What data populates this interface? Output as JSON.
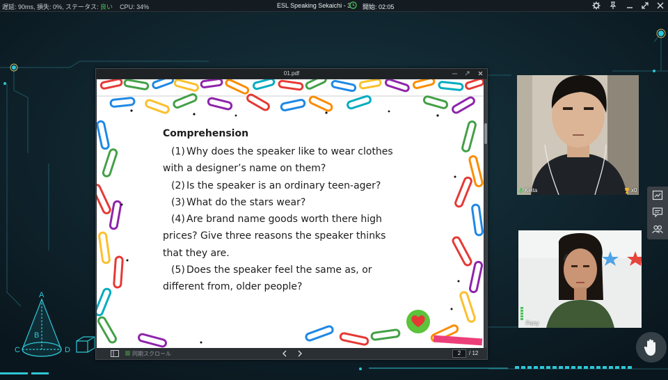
{
  "topbar": {
    "stats_prefix": "遅延: 90ms, 損失: 0%, ステータス: ",
    "status": "良い",
    "cpu": "CPU: 34%",
    "session_title": "ESL Speaking Sekaichi - 3",
    "start_label": "開始: 02:05"
  },
  "pdf": {
    "filename": "01.pdf",
    "heading": "Comprehension",
    "questions": [
      {
        "num": "(1)",
        "lines": [
          "Why does the speaker like to wear clothes",
          "with a designer’s name on them?"
        ]
      },
      {
        "num": "(2)",
        "lines": [
          "Is the speaker is an ordinary teen-ager?"
        ]
      },
      {
        "num": "(3)",
        "lines": [
          "What do the stars wear?"
        ]
      },
      {
        "num": "(4)",
        "lines": [
          "Are brand name goods worth there high",
          "prices? Give three reasons the speaker thinks",
          "that they are."
        ]
      },
      {
        "num": "(5)",
        "lines": [
          "Does the speaker feel the same as, or",
          "different from, older people?"
        ]
      }
    ],
    "sync_scroll_label": "同期スクロール",
    "current_page": "2",
    "total_pages": "/ 12"
  },
  "participants": [
    {
      "name": "Keita",
      "trophies": "x0"
    },
    {
      "name": "Ferry"
    }
  ],
  "decor": {
    "cone_labels": {
      "a": "A",
      "b": "B",
      "c": "C",
      "d": "D"
    }
  },
  "colors": {
    "accent": "#2fc6d6",
    "good": "#4cc35b",
    "background": "#0c1a22"
  },
  "icons": {
    "clock": "clock-icon",
    "settings": "gear-icon",
    "pin": "pin-icon",
    "minimize": "minimize-icon",
    "fullscreen": "fullscreen-icon",
    "close": "close-icon",
    "whiteboard": "whiteboard-icon",
    "chat": "chat-icon",
    "participants": "participants-icon",
    "raise_hand": "hand-icon"
  }
}
